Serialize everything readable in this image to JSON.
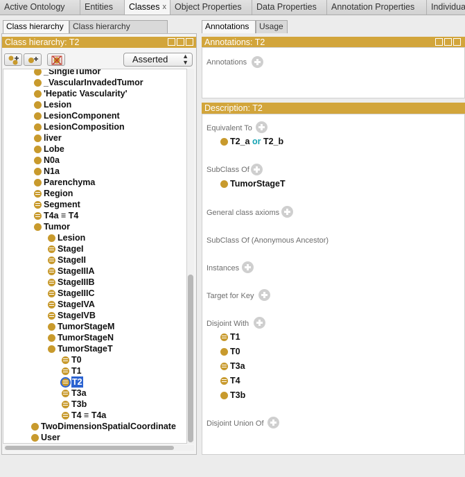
{
  "top_tabs": [
    {
      "label": "Active Ontology",
      "closable": false
    },
    {
      "label": "Entities",
      "closable": false
    },
    {
      "label": "Classes",
      "closable": true,
      "active": true
    },
    {
      "label": "Object Properties",
      "closable": false
    },
    {
      "label": "Data Properties",
      "closable": false
    },
    {
      "label": "Annotation Properties",
      "closable": false
    },
    {
      "label": "Individuals",
      "closable": false
    }
  ],
  "close_glyph": "x",
  "left": {
    "tabs": [
      "Class hierarchy",
      "Class hierarchy (inferred)"
    ],
    "header": "Class hierarchy: T2",
    "toolbar_icons": [
      "add-subclass-icon",
      "add-sibling-icon",
      "delete-class-icon"
    ],
    "dropdown": {
      "selected": "Asserted"
    },
    "tree": [
      {
        "label": "_SingleTumor",
        "icon": "primitive",
        "arrow": "",
        "depth": 1
      },
      {
        "label": "_VascularInvadedTumor",
        "icon": "primitive",
        "arrow": "collapsed",
        "depth": 1
      },
      {
        "label": "'Hepatic Vascularity'",
        "icon": "primitive",
        "arrow": "collapsed",
        "depth": 1
      },
      {
        "label": "Lesion",
        "icon": "primitive",
        "arrow": "collapsed",
        "depth": 1
      },
      {
        "label": "LesionComponent",
        "icon": "primitive",
        "arrow": "",
        "depth": 1
      },
      {
        "label": "LesionComposition",
        "icon": "primitive",
        "arrow": "",
        "depth": 1
      },
      {
        "label": "liver",
        "icon": "primitive",
        "arrow": "",
        "depth": 1
      },
      {
        "label": "Lobe",
        "icon": "primitive",
        "arrow": "",
        "depth": 1
      },
      {
        "label": "N0a",
        "icon": "primitive",
        "arrow": "",
        "depth": 1
      },
      {
        "label": "N1a",
        "icon": "primitive",
        "arrow": "",
        "depth": 1
      },
      {
        "label": "Parenchyma",
        "icon": "primitive",
        "arrow": "",
        "depth": 1
      },
      {
        "label": "Region",
        "icon": "defined",
        "arrow": "",
        "depth": 1
      },
      {
        "label": "Segment",
        "icon": "defined",
        "arrow": "",
        "depth": 1
      },
      {
        "label": "T4a ≡ T4",
        "icon": "defined",
        "arrow": "",
        "depth": 1
      },
      {
        "label": "Tumor",
        "icon": "primitive",
        "arrow": "expanded",
        "depth": 1
      },
      {
        "label": "Lesion",
        "icon": "primitive",
        "arrow": "collapsed",
        "depth": 2
      },
      {
        "label": "StageI",
        "icon": "defined",
        "arrow": "",
        "depth": 2
      },
      {
        "label": "StageII",
        "icon": "defined",
        "arrow": "",
        "depth": 2
      },
      {
        "label": "StageIIIA",
        "icon": "defined",
        "arrow": "",
        "depth": 2
      },
      {
        "label": "StageIIIB",
        "icon": "defined",
        "arrow": "",
        "depth": 2
      },
      {
        "label": "StageIIIC",
        "icon": "defined",
        "arrow": "",
        "depth": 2
      },
      {
        "label": "StageIVA",
        "icon": "defined",
        "arrow": "",
        "depth": 2
      },
      {
        "label": "StageIVB",
        "icon": "defined",
        "arrow": "",
        "depth": 2
      },
      {
        "label": "TumorStageM",
        "icon": "primitive",
        "arrow": "collapsed",
        "depth": 2
      },
      {
        "label": "TumorStageN",
        "icon": "primitive",
        "arrow": "collapsed",
        "depth": 2
      },
      {
        "label": "TumorStageT",
        "icon": "primitive",
        "arrow": "expanded",
        "depth": 2
      },
      {
        "label": "T0",
        "icon": "defined",
        "arrow": "",
        "depth": 3
      },
      {
        "label": "T1",
        "icon": "defined",
        "arrow": "",
        "depth": 3
      },
      {
        "label": "T2",
        "icon": "defined",
        "arrow": "",
        "depth": 3,
        "selected": true
      },
      {
        "label": "T3a",
        "icon": "defined",
        "arrow": "",
        "depth": 3
      },
      {
        "label": "T3b",
        "icon": "defined",
        "arrow": "",
        "depth": 3
      },
      {
        "label": "T4 ≡ T4a",
        "icon": "defined",
        "arrow": "",
        "depth": 3
      },
      {
        "label": "TwoDimensionSpatialCoordinate",
        "icon": "primitive",
        "arrow": "",
        "depth": 0
      },
      {
        "label": "User",
        "icon": "primitive",
        "arrow": "",
        "depth": 0
      }
    ]
  },
  "right": {
    "tabs": [
      "Annotations",
      "Usage"
    ],
    "annotations_header": "Annotations: T2",
    "annotations_label": "Annotations",
    "description_header": "Description: T2",
    "sections": {
      "equivalent_to": "Equivalent To",
      "subclass_of": "SubClass Of",
      "general_axioms": "General class axioms",
      "anon_ancestor": "SubClass Of (Anonymous Ancestor)",
      "instances": "Instances",
      "target_for_key": "Target for Key",
      "disjoint_with": "Disjoint With",
      "disjoint_union_of": "Disjoint Union Of"
    },
    "equivalent": {
      "a": "T2_a",
      "op": "or",
      "b": "T2_b"
    },
    "subclass_item": "TumorStageT",
    "disjoint_items": [
      {
        "label": "T1",
        "icon": "defined"
      },
      {
        "label": "T0",
        "icon": "primitive"
      },
      {
        "label": "T3a",
        "icon": "defined"
      },
      {
        "label": "T4",
        "icon": "defined"
      },
      {
        "label": "T3b",
        "icon": "primitive"
      }
    ]
  },
  "colors": {
    "header_gold": "#d2a53b",
    "class_icon": "#c89a2d",
    "selection": "#2b63d1",
    "keyword": "#16a3b3"
  }
}
